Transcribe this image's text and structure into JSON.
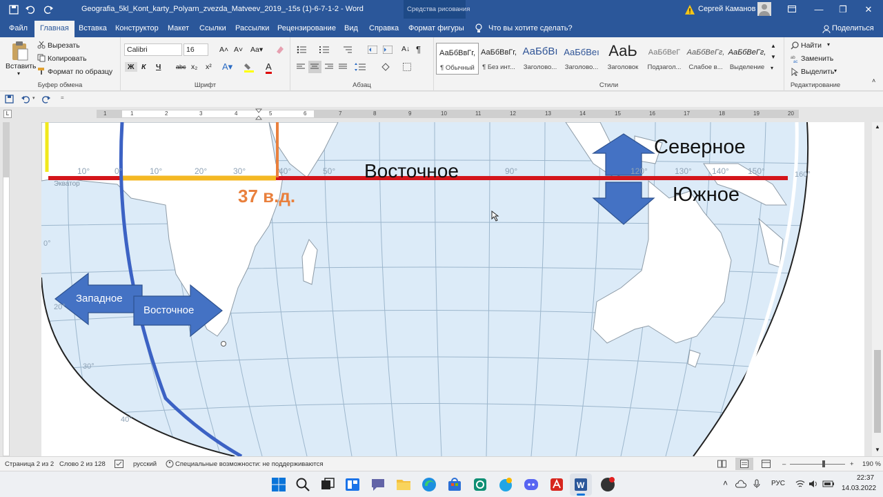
{
  "window": {
    "title": "Geografia_5kl_Kont_karty_Polyarn_zvezda_Matveev_2019_-15s (1)-6-7-1-2  -  Word",
    "context_tab_group": "Средства рисования",
    "user_name": "Сергей Каманов"
  },
  "tabs": [
    "Файл",
    "Главная",
    "Вставка",
    "Конструктор",
    "Макет",
    "Ссылки",
    "Рассылки",
    "Рецензирование",
    "Вид",
    "Справка",
    "Формат фигуры"
  ],
  "tell_me": "Что вы хотите сделать?",
  "share": "Поделиться",
  "clipboard": {
    "paste": "Вставить",
    "cut": "Вырезать",
    "copy": "Копировать",
    "format_painter": "Формат по образцу",
    "label": "Буфер обмена"
  },
  "font": {
    "name": "Calibri",
    "size": "16",
    "label": "Шрифт",
    "bold": "Ж",
    "italic": "К",
    "underline": "Ч",
    "strike": "abc",
    "sub": "x₂",
    "sup": "x²"
  },
  "paragraph": {
    "label": "Абзац"
  },
  "styles": {
    "label": "Стили",
    "items": [
      {
        "sample": "АаБбВвГг,",
        "name": "¶ Обычный"
      },
      {
        "sample": "АаБбВвГг,",
        "name": "¶ Без инт..."
      },
      {
        "sample": "АаБбВı",
        "name": "Заголово..."
      },
      {
        "sample": "АаБбВеı",
        "name": "Заголово..."
      },
      {
        "sample": "АаЬ",
        "name": "Заголовок"
      },
      {
        "sample": "АаБбВеГ",
        "name": "Подзагол..."
      },
      {
        "sample": "АаБбВеГг,",
        "name": "Слабое в..."
      },
      {
        "sample": "АаБбВеГг,",
        "name": "Выделение"
      }
    ]
  },
  "editing": {
    "find": "Найти",
    "replace": "Заменить",
    "select": "Выделить",
    "label": "Редактирование"
  },
  "ruler": {
    "numbers": [
      "1",
      "1",
      "2",
      "3",
      "4",
      "5",
      "6",
      "7",
      "8",
      "9",
      "10",
      "11",
      "12",
      "13",
      "14",
      "15",
      "16",
      "17",
      "18",
      "19",
      "20"
    ]
  },
  "map": {
    "line_label": "Восточное",
    "equator": "Экватор",
    "meridian_label": "37 в.д.",
    "north": "Северное",
    "south": "Южное",
    "arrow_west": "Западное",
    "arrow_east": "Восточное",
    "lon_labels": [
      "10°",
      "0°",
      "10°",
      "20°",
      "30°",
      "40°",
      "50°",
      "90°",
      "120°",
      "130°",
      "140°",
      "150°",
      "160°"
    ],
    "lat_labels": [
      "0°",
      "20°",
      "30°",
      "40°"
    ]
  },
  "status": {
    "page": "Страница 2 из 2",
    "words": "Слово 2 из 128",
    "language": "русский",
    "accessibility": "Специальные возможности: не поддерживаются",
    "zoom": "190 %"
  },
  "tray": {
    "lang": "РУС",
    "time": "22:37",
    "date": "14.03.2022"
  }
}
